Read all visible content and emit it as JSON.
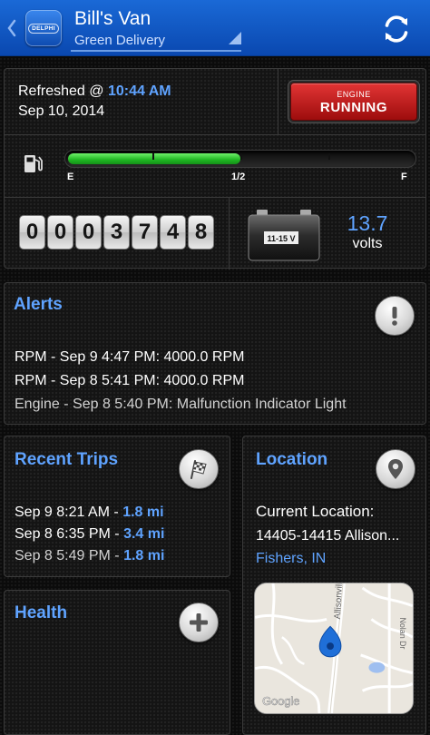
{
  "header": {
    "brand": "DELPHI",
    "vehicle_name": "Bill's Van",
    "vehicle_subtitle": "Green Delivery"
  },
  "status": {
    "refreshed_prefix": "Refreshed @ ",
    "refreshed_time": "10:44 AM",
    "refreshed_date": "Sep 10, 2014",
    "engine_line1": "ENGINE",
    "engine_line2": "RUNNING",
    "fuel": {
      "level_fraction": 0.5,
      "label_empty": "E",
      "label_half": "1/2",
      "label_full": "F"
    },
    "odometer_digits": [
      "0",
      "0",
      "0",
      "3",
      "7",
      "4",
      "8"
    ],
    "battery_label": "11-15 V",
    "volts_value": "13.7",
    "volts_unit": "volts"
  },
  "alerts": {
    "title": "Alerts",
    "items": [
      {
        "text": "RPM - Sep 9 4:47 PM: 4000.0 RPM"
      },
      {
        "text": "RPM - Sep 8 5:41 PM: 4000.0 RPM"
      },
      {
        "text": "Engine - Sep 8 5:40 PM: Malfunction Indicator Light"
      }
    ]
  },
  "trips": {
    "title": "Recent Trips",
    "items": [
      {
        "label": "Sep 9 8:21 AM - ",
        "distance": "1.8 mi"
      },
      {
        "label": "Sep 8 6:35 PM - ",
        "distance": "3.4 mi"
      },
      {
        "label": "Sep 8 5:49 PM - ",
        "distance": "1.8 mi"
      }
    ]
  },
  "health": {
    "title": "Health"
  },
  "location": {
    "title": "Location",
    "current_label": "Current Location:",
    "address": "14405-14415 Allison...",
    "city": "Fishers, IN",
    "map_road_label": "Allisonville Rd",
    "map_road_label2": "Nolan Dr",
    "map_attribution": "Google"
  },
  "colors": {
    "accent_blue": "#5fa3ff",
    "header_blue": "#0a48b0",
    "engine_red": "#c41e1e",
    "fuel_green": "#1fb522"
  },
  "icons": {
    "back": "chevron-left-icon",
    "refresh": "refresh-icon",
    "alerts": "exclamation-icon",
    "trips": "checkered-flag-icon",
    "health": "plus-icon",
    "location": "map-pin-icon",
    "fuel": "fuel-pump-icon",
    "battery": "battery-icon"
  }
}
